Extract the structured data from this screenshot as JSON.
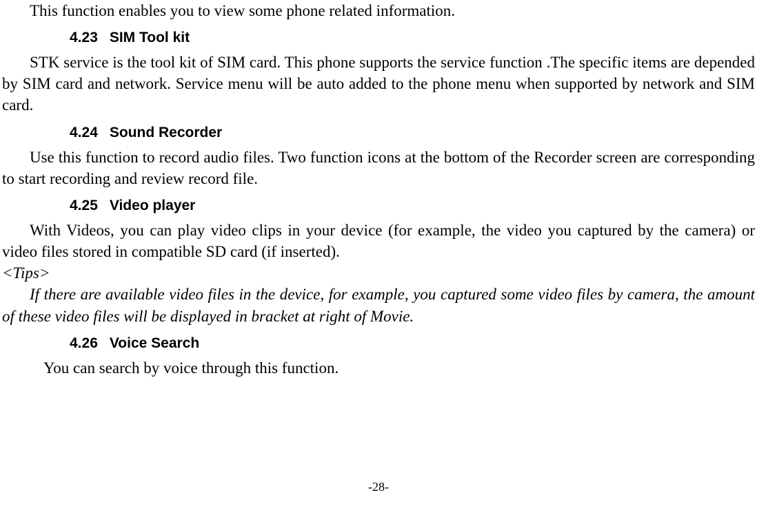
{
  "intro": "This function enables you to view some phone related information.",
  "sections": {
    "s423": {
      "num": "4.23",
      "title": "SIM Tool kit",
      "body": "STK service is the tool kit of SIM card. This phone supports the service function .The specific items are depended by SIM card and network. Service menu will be auto added to the phone menu when supported by network and SIM card."
    },
    "s424": {
      "num": "4.24",
      "title": "Sound Recorder",
      "body": "Use this function to record audio files. Two function icons at the bottom of the Recorder screen are corresponding to start recording and review record file."
    },
    "s425": {
      "num": "4.25",
      "title": "Video player",
      "body": "With Videos, you can play video clips in your device (for example, the video you captured by the camera) or video files stored in compatible SD card (if inserted).",
      "tips_label": "<Tips>",
      "tips_body": "If there are available video files in the device, for example, you captured some video files by camera, the amount of these video files will be displayed in bracket at right of Movie."
    },
    "s426": {
      "num": "4.26",
      "title": "Voice Search",
      "body": "You can search by voice through this function."
    }
  },
  "page_number": "-28-"
}
